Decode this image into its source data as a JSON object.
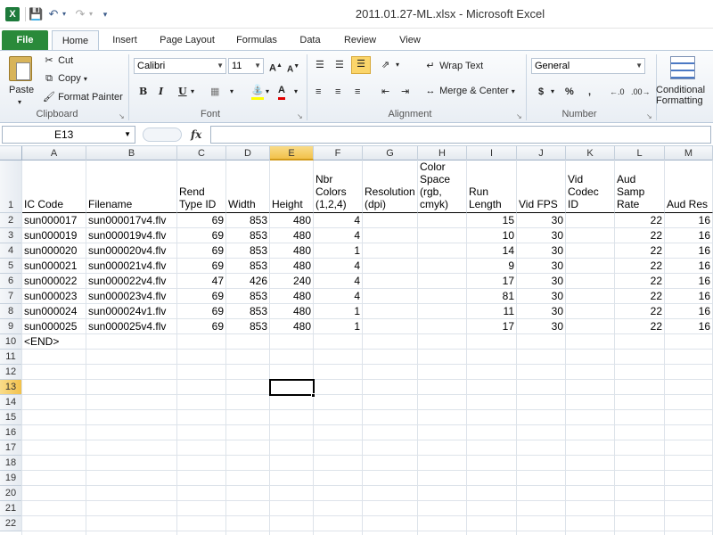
{
  "window": {
    "title": "2011.01.27-ML.xlsx  -  Microsoft Excel",
    "app_icon": "excel-logo-icon"
  },
  "quick_access": {
    "save_icon": "save-icon",
    "undo_icon": "undo-icon",
    "redo_icon": "redo-icon",
    "customize_icon": "customize-quick-access-icon"
  },
  "tabs": [
    {
      "label": "File"
    },
    {
      "label": "Home"
    },
    {
      "label": "Insert"
    },
    {
      "label": "Page Layout"
    },
    {
      "label": "Formulas"
    },
    {
      "label": "Data"
    },
    {
      "label": "Review"
    },
    {
      "label": "View"
    }
  ],
  "ribbon": {
    "clipboard": {
      "paste": "Paste",
      "cut": "Cut",
      "copy": "Copy",
      "format_painter": "Format Painter",
      "group_label": "Clipboard"
    },
    "font": {
      "name": "Calibri",
      "size": "11",
      "bold": "B",
      "italic": "I",
      "underline": "U",
      "group_label": "Font"
    },
    "alignment": {
      "wrap_text": "Wrap Text",
      "merge_center": "Merge & Center",
      "group_label": "Alignment"
    },
    "number": {
      "format": "General",
      "currency": "$",
      "percent": "%",
      "comma": ",",
      "group_label": "Number"
    },
    "styles": {
      "conditional_formatting_line1": "Conditional",
      "conditional_formatting_line2": "Formatting"
    }
  },
  "formula_bar": {
    "name_box": "E13",
    "fx": "fx",
    "value": ""
  },
  "sheet": {
    "columns": [
      "A",
      "B",
      "C",
      "D",
      "E",
      "F",
      "G",
      "H",
      "I",
      "J",
      "K",
      "L",
      "M"
    ],
    "selected_column": "E",
    "selected_row": "13",
    "row_numbers": [
      "1",
      "2",
      "3",
      "4",
      "5",
      "6",
      "7",
      "8",
      "9",
      "10",
      "11",
      "12",
      "13",
      "14",
      "15",
      "16",
      "17",
      "18",
      "19",
      "20",
      "21",
      "22"
    ],
    "header_row": [
      "IC Code",
      "Filename",
      "Rend\nType ID",
      "Width",
      "Height",
      "Nbr\nColors\n(1,2,4)",
      "Resolution\n(dpi)",
      "Color\nSpace\n(rgb,\ncmyk)",
      "Run\nLength",
      "Vid FPS",
      "Vid\nCodec ID",
      "Aud\nSamp\nRate",
      "Aud Res"
    ],
    "rows": [
      [
        "sun000017",
        "sun000017v4.flv",
        "69",
        "853",
        "480",
        "4",
        "",
        "",
        "15",
        "30",
        "",
        "22",
        "16"
      ],
      [
        "sun000019",
        "sun000019v4.flv",
        "69",
        "853",
        "480",
        "4",
        "",
        "",
        "10",
        "30",
        "",
        "22",
        "16"
      ],
      [
        "sun000020",
        "sun000020v4.flv",
        "69",
        "853",
        "480",
        "1",
        "",
        "",
        "14",
        "30",
        "",
        "22",
        "16"
      ],
      [
        "sun000021",
        "sun000021v4.flv",
        "69",
        "853",
        "480",
        "4",
        "",
        "",
        "9",
        "30",
        "",
        "22",
        "16"
      ],
      [
        "sun000022",
        "sun000022v4.flv",
        "47",
        "426",
        "240",
        "4",
        "",
        "",
        "17",
        "30",
        "",
        "22",
        "16"
      ],
      [
        "sun000023",
        "sun000023v4.flv",
        "69",
        "853",
        "480",
        "4",
        "",
        "",
        "81",
        "30",
        "",
        "22",
        "16"
      ],
      [
        "sun000024",
        "sun000024v1.flv",
        "69",
        "853",
        "480",
        "1",
        "",
        "",
        "11",
        "30",
        "",
        "22",
        "16"
      ],
      [
        "sun000025",
        "sun000025v4.flv",
        "69",
        "853",
        "480",
        "1",
        "",
        "",
        "17",
        "30",
        "",
        "22",
        "16"
      ]
    ],
    "end_marker": "<END>"
  }
}
